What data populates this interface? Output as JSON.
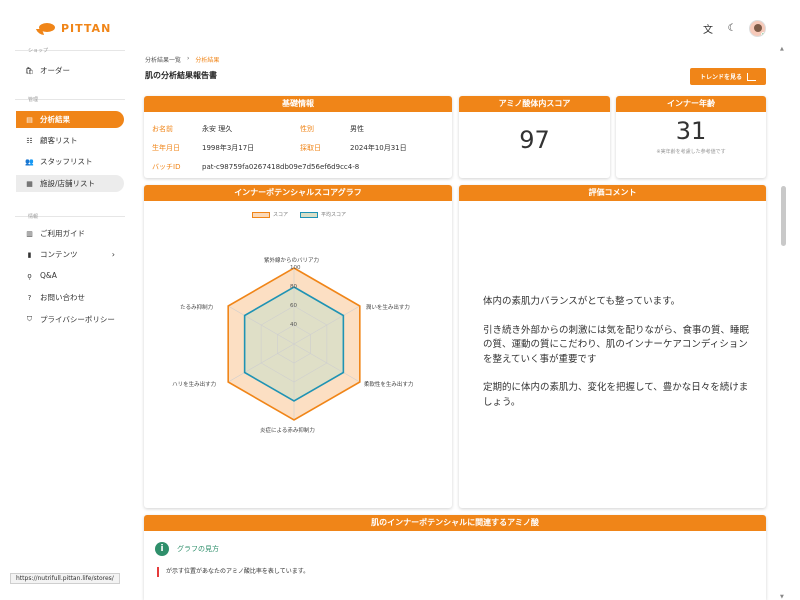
{
  "brand": {
    "name": "PITTAN",
    "color": "#f08518"
  },
  "header": {
    "icons": [
      "translate-icon",
      "dark-mode-icon",
      "avatar"
    ]
  },
  "sidebar": {
    "section_shop": "ショップ",
    "section_manage": "管理",
    "section_info": "情報",
    "items": [
      {
        "label": "オーダー",
        "icon": "bag-icon"
      },
      {
        "label": "分析結果",
        "icon": "chart-icon",
        "active": true
      },
      {
        "label": "顧客リスト",
        "icon": "customer-list-icon"
      },
      {
        "label": "スタッフリスト",
        "icon": "staff-icon"
      },
      {
        "label": "施設/店舗リスト",
        "icon": "store-icon"
      },
      {
        "label": "ご利用ガイド",
        "icon": "guide-icon"
      },
      {
        "label": "コンテンツ",
        "icon": "book-icon"
      },
      {
        "label": "Q&A",
        "icon": "qa-icon"
      },
      {
        "label": "お問い合わせ",
        "icon": "help-icon"
      },
      {
        "label": "プライバシーポリシー",
        "icon": "shield-icon"
      }
    ]
  },
  "breadcrumb": {
    "parent": "分析結果一覧",
    "sep": "›",
    "current": "分析結果"
  },
  "page": {
    "title": "肌の分析結果報告書",
    "trend_button": "トレンドを見る"
  },
  "basic_info": {
    "title": "基礎情報",
    "name_label": "お名前",
    "name": "永安 理久",
    "gender_label": "性別",
    "gender": "男性",
    "birth_label": "生年月日",
    "birth": "1998年3月17日",
    "collected_label": "採取日",
    "collected": "2024年10月31日",
    "batch_label": "バッチID",
    "batch": "pat-c98759fa0267418db09e7d56ef6d9cc4-8"
  },
  "amino_score": {
    "title": "アミノ酸体内スコア",
    "value": "97"
  },
  "inner_age": {
    "title": "インナー年齢",
    "value": "31",
    "note": "※実年齢を考慮した参考値です"
  },
  "radar_card": {
    "title": "インナーポテンシャルスコアグラフ"
  },
  "comment_card": {
    "title": "評価コメント",
    "paragraphs": [
      "体内の素肌力バランスがとても整っています。",
      "引き続き外部からの刺激には気を配りながら、食事の質、睡眠の質、運動の質にこだわり、肌のインナーケアコンディションを整えていく事が重要です",
      "定期的に体内の素肌力、変化を把握して、豊かな日々を続けましょう。"
    ]
  },
  "amino_section": {
    "title": "肌のインナーポテンシャルに関連するアミノ酸",
    "guide_title": "グラフの見方",
    "guide_text": "が示す位置があなたのアミノ酸比率を表しています。"
  },
  "status_url": "https://nutrifull.pittan.life/stores/",
  "chart_data": {
    "type": "radar",
    "axes": [
      "紫外線からのバリア力",
      "潤いを生み出す力",
      "柔軟性を生み出す力",
      "炎症による赤み抑制力",
      "ハリを生み出す力",
      "たるみ抑制力"
    ],
    "ticks": [
      "40",
      "60",
      "80",
      "100"
    ],
    "rlim": [
      20,
      100
    ],
    "series": [
      {
        "name": "スコア",
        "values": [
          100,
          100,
          100,
          100,
          100,
          100
        ],
        "color": "#f08518",
        "fill": "#fbd9b8"
      },
      {
        "name": "平均スコア",
        "values": [
          80,
          80,
          80,
          80,
          80,
          80
        ],
        "color": "#1f93b4",
        "fill": "#d9dfc8"
      }
    ],
    "legend": "top-center",
    "grid": true
  }
}
